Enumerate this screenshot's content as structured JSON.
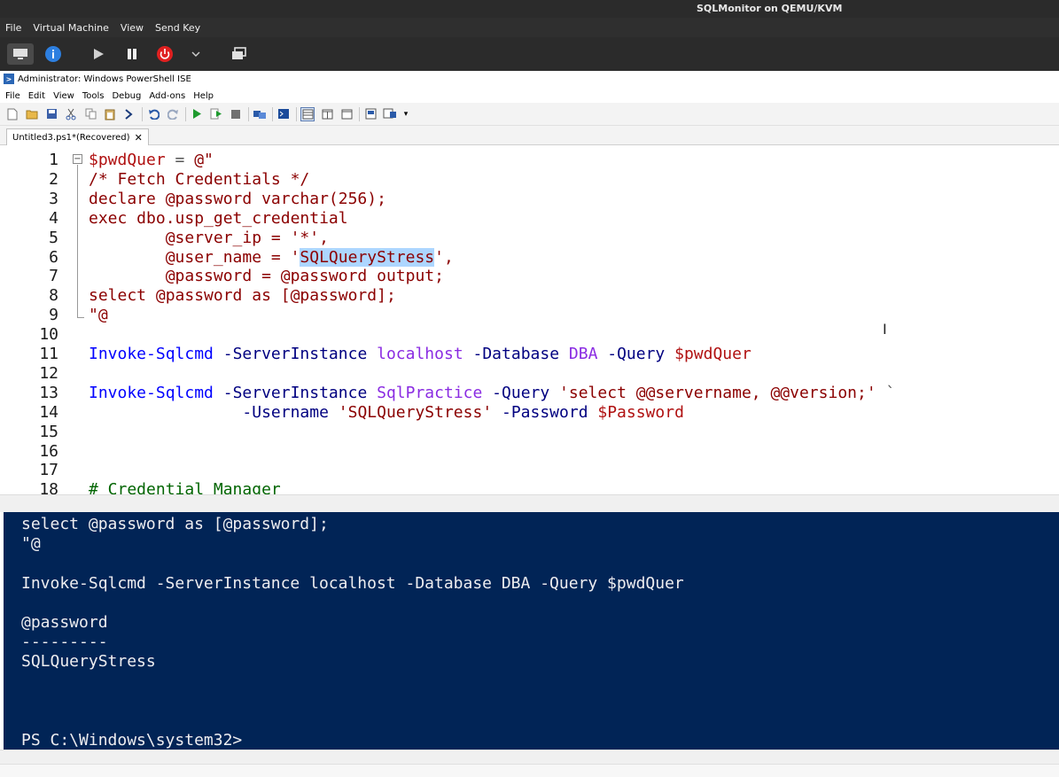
{
  "host": {
    "title": "SQLMonitor on QEMU/KVM",
    "menu": [
      "File",
      "Virtual Machine",
      "View",
      "Send Key"
    ],
    "toolbar_icons": [
      "monitor-icon",
      "info-icon",
      "play-icon",
      "pause-icon",
      "power-icon",
      "chevron-down-icon",
      "screens-icon"
    ]
  },
  "ise": {
    "title": "Administrator: Windows PowerShell ISE",
    "menu": [
      "File",
      "Edit",
      "View",
      "Tools",
      "Debug",
      "Add-ons",
      "Help"
    ],
    "tab_label": "Untitled3.ps1*(Recovered)",
    "tab_close": "✕"
  },
  "script": {
    "line_numbers": [
      "1",
      "2",
      "3",
      "4",
      "5",
      "6",
      "7",
      "8",
      "9",
      "10",
      "11",
      "12",
      "13",
      "14",
      "15",
      "16",
      "17",
      "18"
    ],
    "lines": [
      [
        {
          "t": "$pwdQuer",
          "c": "c-var"
        },
        {
          "t": " = ",
          "c": "c-op"
        },
        {
          "t": "@\"",
          "c": "c-str"
        }
      ],
      [
        {
          "t": "/* Fetch Credentials */",
          "c": "c-str"
        }
      ],
      [
        {
          "t": "declare @password varchar(256);",
          "c": "c-str"
        }
      ],
      [
        {
          "t": "exec dbo.usp_get_credential",
          "c": "c-str"
        }
      ],
      [
        {
          "t": "        @server_ip = '*',",
          "c": "c-str"
        }
      ],
      [
        {
          "t": "        @user_name = '",
          "c": "c-str"
        },
        {
          "t": "SQLQueryStress",
          "c": "c-str sel"
        },
        {
          "t": "',",
          "c": "c-str"
        }
      ],
      [
        {
          "t": "        @password = @password output;",
          "c": "c-str"
        }
      ],
      [
        {
          "t": "select @password as [@password];",
          "c": "c-str"
        }
      ],
      [
        {
          "t": "\"@",
          "c": "c-str"
        }
      ],
      [],
      [
        {
          "t": "Invoke-Sqlcmd",
          "c": "c-cmd"
        },
        {
          "t": " -ServerInstance ",
          "c": "c-param"
        },
        {
          "t": "localhost",
          "c": "c-arg"
        },
        {
          "t": " -Database ",
          "c": "c-param"
        },
        {
          "t": "DBA",
          "c": "c-arg"
        },
        {
          "t": " -Query ",
          "c": "c-param"
        },
        {
          "t": "$pwdQuer",
          "c": "c-var"
        }
      ],
      [],
      [
        {
          "t": "Invoke-Sqlcmd",
          "c": "c-cmd"
        },
        {
          "t": " -ServerInstance ",
          "c": "c-param"
        },
        {
          "t": "SqlPractice",
          "c": "c-arg"
        },
        {
          "t": " -Query ",
          "c": "c-param"
        },
        {
          "t": "'select @@servername, @@version;'",
          "c": "c-str"
        },
        {
          "t": " `",
          "c": "c-op"
        }
      ],
      [
        {
          "t": "                ",
          "c": "c-op"
        },
        {
          "t": "-Username ",
          "c": "c-param"
        },
        {
          "t": "'SQLQueryStress'",
          "c": "c-str"
        },
        {
          "t": " -Password ",
          "c": "c-param"
        },
        {
          "t": "$Password",
          "c": "c-var"
        }
      ],
      [],
      [],
      [],
      [
        {
          "t": "# Credential Manager",
          "c": "c-comment"
        }
      ]
    ]
  },
  "console": {
    "lines": [
      "select @password as [@password];",
      "\"@",
      "",
      "Invoke-Sqlcmd -ServerInstance localhost -Database DBA -Query $pwdQuer",
      "",
      "@password",
      "---------",
      "SQLQueryStress",
      "",
      "",
      "",
      "PS C:\\Windows\\system32>"
    ]
  }
}
